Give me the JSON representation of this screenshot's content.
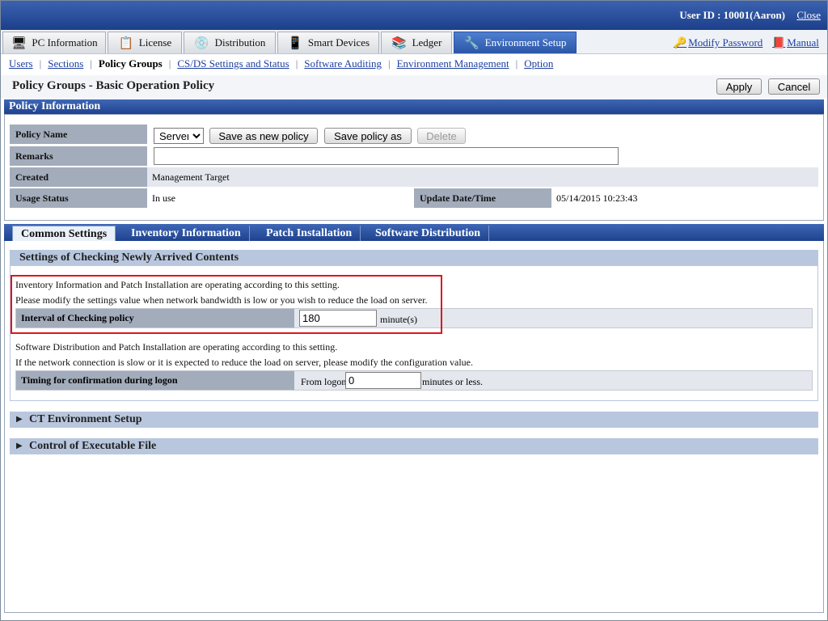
{
  "header": {
    "user_id": "User ID : 10001(Aaron)",
    "close": "Close"
  },
  "main_tabs": [
    {
      "label": "PC Information",
      "icon": "pc-icon"
    },
    {
      "label": "License",
      "icon": "license-icon"
    },
    {
      "label": "Distribution",
      "icon": "distribution-icon"
    },
    {
      "label": "Smart Devices",
      "icon": "smartphone-icon"
    },
    {
      "label": "Ledger",
      "icon": "ledger-icon"
    },
    {
      "label": "Environment Setup",
      "icon": "tools-icon",
      "active": true
    }
  ],
  "top_links": {
    "modify_password": "Modify Password",
    "manual": "Manual"
  },
  "subnav": {
    "items": [
      "Users",
      "Sections",
      "Policy Groups",
      "CS/DS Settings and Status",
      "Software Auditing",
      "Environment Management",
      "Option"
    ],
    "current": "Policy Groups"
  },
  "page": {
    "title": "Policy Groups - Basic Operation Policy",
    "apply": "Apply",
    "cancel": "Cancel"
  },
  "policy_info": {
    "header": "Policy Information",
    "policy_name_label": "Policy Name",
    "policy_select_value": "Server",
    "save_new": "Save as new policy",
    "save_as": "Save policy as",
    "delete": "Delete",
    "remarks_label": "Remarks",
    "remarks_value": "",
    "created_label": "Created",
    "created_value": "Management Target",
    "usage_label": "Usage Status",
    "usage_value": "In use",
    "update_label": "Update Date/Time",
    "update_value": "05/14/2015 10:23:43"
  },
  "settings_tabs": [
    "Common Settings",
    "Inventory Information",
    "Patch Installation",
    "Software Distribution"
  ],
  "checking": {
    "header": "Settings of Checking Newly Arrived Contents",
    "desc1a": "Inventory Information and Patch Installation are operating according to this setting.",
    "desc1b": "Please modify the settings value when network bandwidth is low or you wish to reduce the load on server.",
    "interval_label": "Interval of Checking policy",
    "interval_value": "180",
    "interval_unit": "minute(s)",
    "desc2a": "Software Distribution and Patch Installation are operating according to this setting.",
    "desc2b": "If the network connection is slow or it is expected to reduce the load on server, please modify the configuration value.",
    "timing_label": "Timing for confirmation during logon",
    "timing_prefix": "From logon",
    "timing_value": "0",
    "timing_suffix": "minutes or less."
  },
  "collapsibles": {
    "ct_env": "CT Environment Setup",
    "exec_control": "Control of Executable File"
  }
}
